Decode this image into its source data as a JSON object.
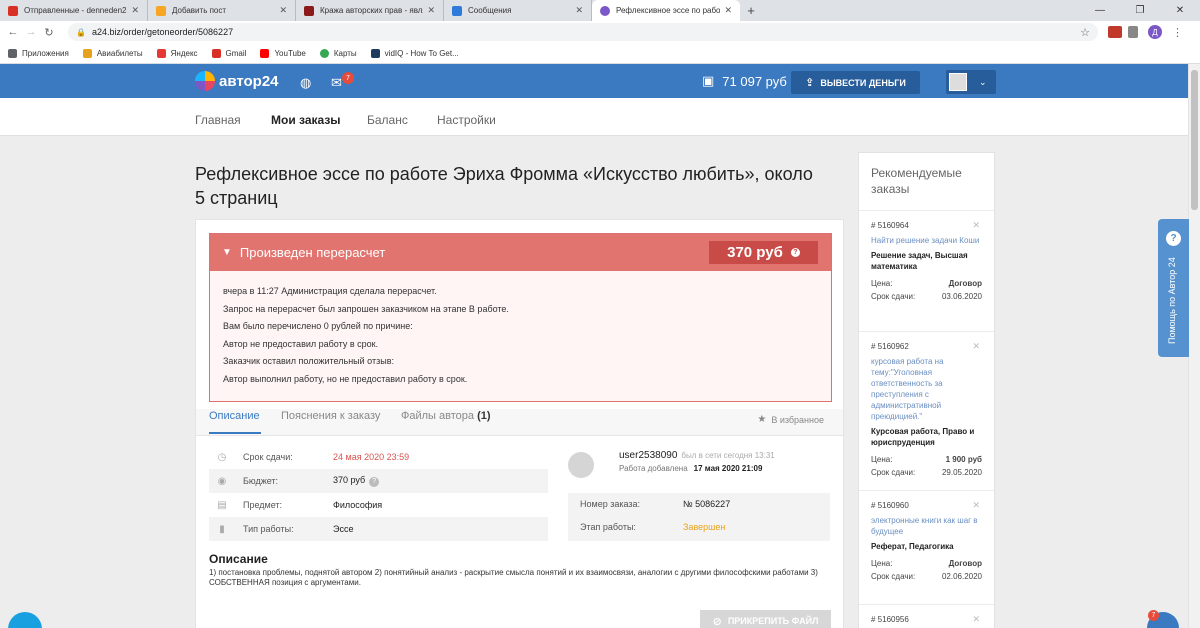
{
  "browser": {
    "tabs": [
      {
        "title": "Отправленные - denneden23@",
        "color": "#d93025",
        "active": false
      },
      {
        "title": "Добавить пост",
        "color": "#f6a623",
        "active": false
      },
      {
        "title": "Кража авторских прав - являет",
        "color": "#8b1a1a",
        "active": false
      },
      {
        "title": "Сообщения",
        "color": "#2f7bd9",
        "active": false
      },
      {
        "title": "Рефлексивное эссе по работе Э",
        "color": "#7b57c8",
        "active": true
      }
    ],
    "new_tab": "+",
    "url": "a24.biz/order/getoneorder/5086227",
    "profile_letter": "Д",
    "bookmarks": [
      {
        "label": "Приложения",
        "color": "#5f6368"
      },
      {
        "label": "Авиабилеты",
        "color": "#e6a11d"
      },
      {
        "label": "Яндекс",
        "color": "#e53935"
      },
      {
        "label": "Gmail",
        "color": "#d93025"
      },
      {
        "label": "YouTube",
        "color": "#ff0000"
      },
      {
        "label": "Карты",
        "color": "#34a853"
      },
      {
        "label": "vidIQ - How To Get...",
        "color": "#1e3a5f"
      }
    ]
  },
  "site": {
    "logo_text": "автор24",
    "messages_count": "7",
    "balance": "71 097 руб",
    "withdraw_label": "ВЫВЕСТИ ДЕНЬГИ",
    "nav": [
      "Главная",
      "Мои заказы",
      "Баланс",
      "Настройки"
    ],
    "active_nav": 1
  },
  "order": {
    "title": "Рефлексивное эссе по работе Эриха Фромма «Искусство любить», около 5 страниц",
    "alert": {
      "heading": "Произведен перерасчет",
      "price": "370 руб",
      "lines": [
        "вчера в 11:27 Администрация сделала перерасчет.",
        "Запрос на перерасчет был запрошен заказчиком на этапе В работе.",
        "Вам было перечислено 0 рублей по причине:",
        "Автор не предоставил работу в срок.",
        "Заказчик оставил положительный отзыв:",
        "Автор выполнил работу, но не предоставил работу в срок."
      ]
    },
    "tabs": {
      "description": "Описание",
      "explanations": "Пояснения к заказу",
      "files": "Файлы автора",
      "files_count": "(1)",
      "favorite": "В избранное"
    },
    "details": [
      {
        "label": "Срок сдачи:",
        "value": "24 мая 2020 23:59",
        "icon": "clock-icon"
      },
      {
        "label": "Бюджет:",
        "value": "370 руб",
        "icon": "money-icon"
      },
      {
        "label": "Предмет:",
        "value": "Философия",
        "icon": "subject-icon"
      },
      {
        "label": "Тип работы:",
        "value": "Эссе",
        "icon": "work-type-icon"
      }
    ],
    "author": {
      "name": "user2538090",
      "status": "был в сети сегодня 13:31",
      "added_label": "Работа добавлена",
      "added_date": "17 мая 2020 21:09"
    },
    "order_number_label": "Номер заказа:",
    "order_number": "№ 5086227",
    "stage_label": "Этап работы:",
    "stage": "Завершен",
    "description_title": "Описание",
    "description_text": "1) постановка проблемы, поднятой автором 2) понятийный анализ - раскрытие смысла понятий и их взаимосвязи, аналогии с другими философскими работами 3) СОБСТВЕННАЯ позиция с аргументами.",
    "attach_label": "ПРИКРЕПИТЬ ФАЙЛ"
  },
  "sidebar": {
    "title": "Рекомендуемые заказы",
    "items": [
      {
        "id": "# 5160964",
        "link": "Найти решение задачи Коши",
        "type": "Решение задач, Высшая математика",
        "price_label": "Цена:",
        "price": "Договор",
        "due_label": "Срок сдачи:",
        "due": "03.06.2020"
      },
      {
        "id": "# 5160962",
        "link": "курсовая работа на тему:\"Уголовная ответственность за преступления с административной преюдицией.\"",
        "type": "Курсовая работа, Право и юриспруденция",
        "price_label": "Цена:",
        "price": "1 900 руб",
        "due_label": "Срок сдачи:",
        "due": "29.05.2020"
      },
      {
        "id": "# 5160960",
        "link": "электронные книги как шаг в будущее",
        "type": "Реферат, Педагогика",
        "price_label": "Цена:",
        "price": "Договор",
        "due_label": "Срок сдачи:",
        "due": "02.06.2020"
      },
      {
        "id": "# 5160956"
      }
    ]
  },
  "help": {
    "label": "Помощь по Автор 24",
    "chat_badge": "7"
  }
}
